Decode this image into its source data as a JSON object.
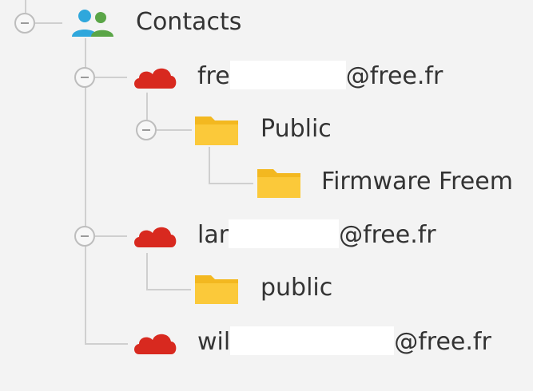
{
  "tree": {
    "root": {
      "label": "Contacts",
      "icon": "contacts-group-icon"
    },
    "accounts": [
      {
        "prefix": "fre",
        "suffix": "@free.fr",
        "icon": "cloud-icon",
        "folders": [
          {
            "label": "Public",
            "icon": "folder-icon",
            "children": [
              {
                "label": "Firmware Freem",
                "icon": "folder-icon"
              }
            ]
          }
        ]
      },
      {
        "prefix": "lar",
        "suffix": "@free.fr",
        "icon": "cloud-icon",
        "folders": [
          {
            "label": "public",
            "icon": "folder-icon"
          }
        ]
      },
      {
        "prefix": "wil",
        "suffix": "@free.fr",
        "icon": "cloud-icon",
        "folders": []
      }
    ]
  },
  "colors": {
    "cloud": "#d8291f",
    "folder": "#fbc93a",
    "contacts_blue": "#2fa7dc",
    "contacts_green": "#5aa547",
    "connector": "#cfcfcf",
    "background": "#f3f3f3"
  }
}
